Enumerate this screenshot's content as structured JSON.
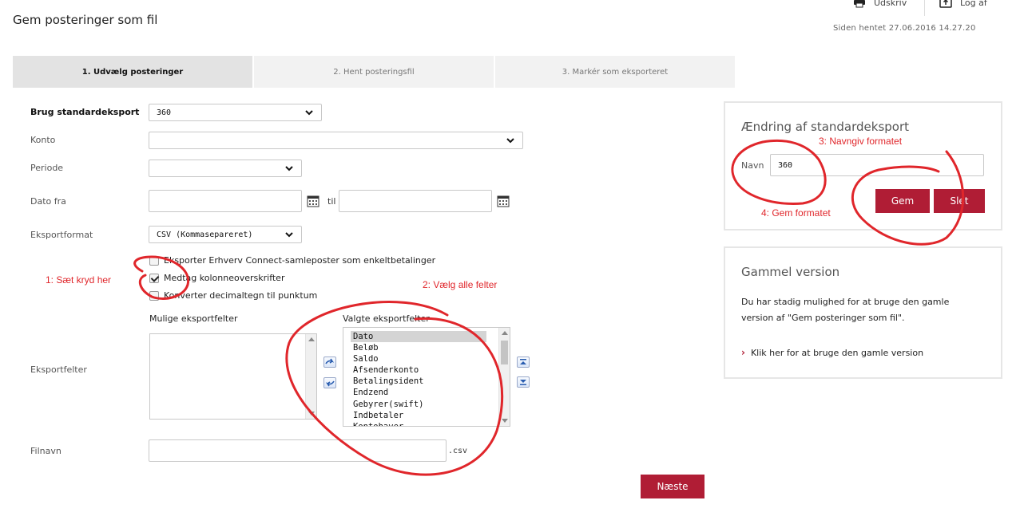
{
  "header": {
    "title": "Gem posteringer som fil",
    "print_label": "Udskriv",
    "logout_label": "Log af",
    "fetched_text": "Siden hentet 27.06.2016 14.27.20"
  },
  "steps": [
    {
      "label": "1. Udvælg posteringer",
      "active": true
    },
    {
      "label": "2. Hent posteringsfil",
      "active": false
    },
    {
      "label": "3. Markér som eksporteret",
      "active": false
    }
  ],
  "form": {
    "standard_export_label": "Brug standardeksport",
    "standard_export_value": "360",
    "account_label": "Konto",
    "account_value": "",
    "period_label": "Periode",
    "period_value": "",
    "date_from_label": "Dato fra",
    "date_from_value": "",
    "date_to_label": "til",
    "date_to_value": "",
    "export_format_label": "Eksportformat",
    "export_format_value": "CSV (Kommasepareret)",
    "checkboxes": [
      {
        "label": "Eksporter Erhverv Connect-samleposter som enkeltbetalinger",
        "checked": false
      },
      {
        "label": "Medtag kolonneoverskrifter",
        "checked": true
      },
      {
        "label": "Konverter decimaltegn til punktum",
        "checked": false
      }
    ],
    "export_fields_label": "Eksportfelter",
    "possible_fields_label": "Mulige eksportfelter",
    "selected_fields_label": "Valgte eksportfelter",
    "selected_fields": [
      "Dato",
      "Beløb",
      "Saldo",
      "Afsenderkonto",
      "Betalingsident",
      "Endzend",
      "Gebyrer(swift)",
      "Indbetaler",
      "Kontohaver"
    ],
    "filename_label": "Filnavn",
    "filename_value": "",
    "filename_ext": ".csv",
    "next_label": "Næste"
  },
  "change_panel": {
    "title": "Ændring af standardeksport",
    "name_label": "Navn",
    "name_value": "360",
    "save_label": "Gem",
    "delete_label": "Slet"
  },
  "old_panel": {
    "title": "Gammel version",
    "text": "Du har stadig mulighed for at bruge den gamle version af \"Gem posteringer som fil\".",
    "link_label": "Klik her for at bruge den gamle version"
  },
  "annotations": {
    "note1": "1: Sæt kryd her",
    "note2": "2: Vælg alle felter",
    "note3": "3: Navngiv formatet",
    "note4": "4: Gem formatet",
    "color": "#e0262b"
  },
  "colors": {
    "accent": "#b01d35"
  }
}
